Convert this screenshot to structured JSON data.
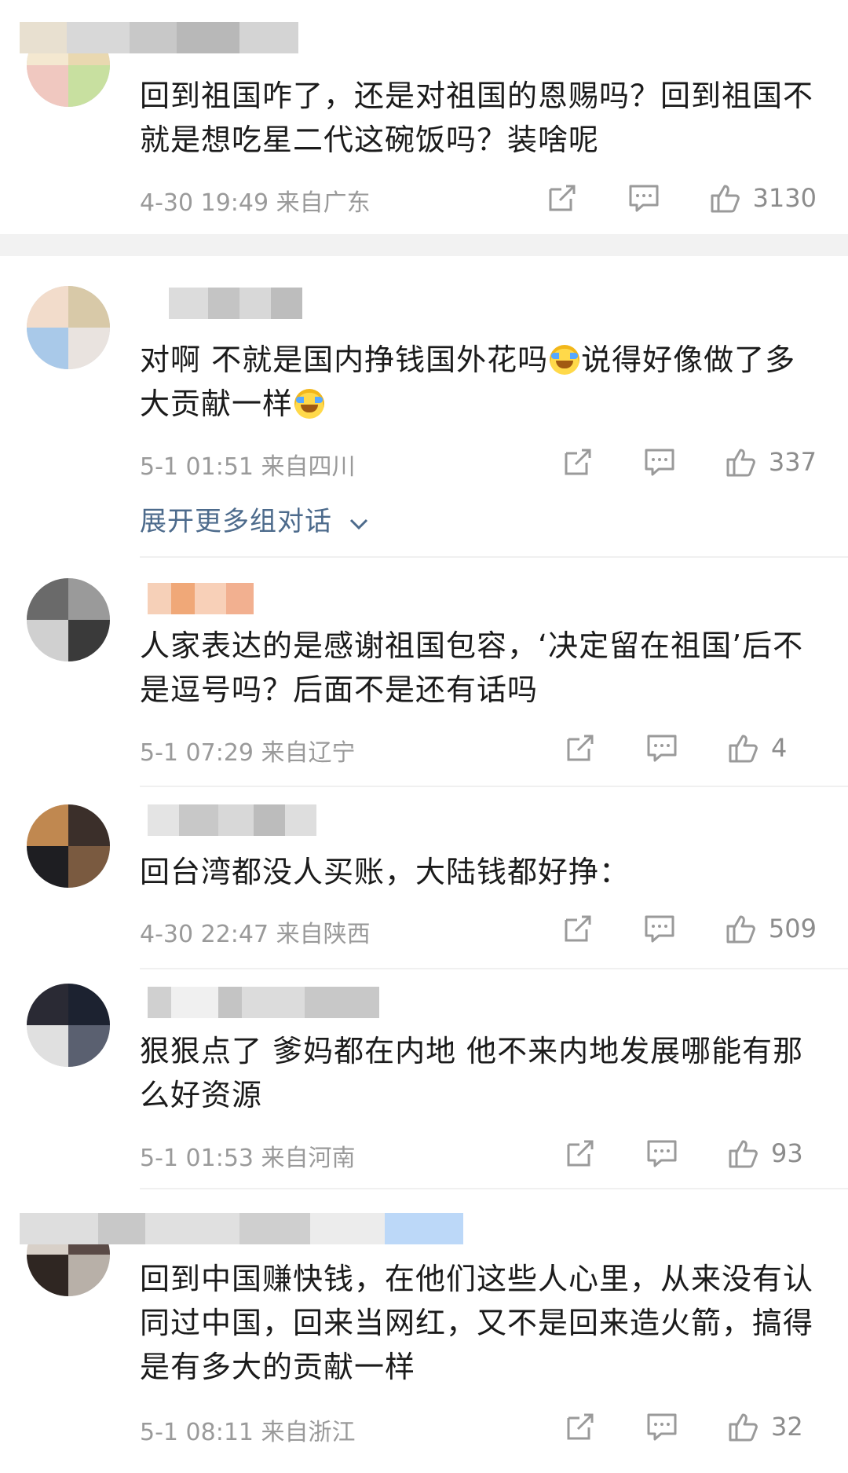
{
  "comments": [
    {
      "text": "回到祖国咋了，还是对祖国的恩赐吗？回到祖国不就是想吃星二代这碗饭吗？装啥呢",
      "meta": "4-30 19:49 来自广东",
      "likes": "3130",
      "avatar_colors": [
        "#e9d8b0",
        "#c8e0a0",
        "#f0c8c0",
        "#f4e8d0"
      ]
    },
    {
      "text_before": "对啊 不就是国内挣钱国外花吗",
      "text_mid": "说得好像做了多大贡献一样",
      "meta": "5-1 01:51 来自四川",
      "likes": "337",
      "avatar_colors": [
        "#d8c9a8",
        "#e9e3df",
        "#a9c9e9",
        "#f2dccb"
      ]
    },
    {
      "text": "人家表达的是感谢祖国包容，‘决定留在祖国’后不是逗号吗？后面不是还有话吗",
      "meta": "5-1 07:29 来自辽宁",
      "likes": "4",
      "avatar_colors": [
        "#9a9a9a",
        "#3a3a3a",
        "#d0d0d0",
        "#6a6a6a"
      ]
    },
    {
      "text": "回台湾都没人买账，大陆钱都好挣：",
      "meta": "4-30 22:47 来自陕西",
      "likes": "509",
      "avatar_colors": [
        "#3b2f2a",
        "#7a5a40",
        "#1e1e22",
        "#c08850"
      ]
    },
    {
      "text": "狠狠点了 爹妈都在内地 他不来内地发展哪能有那么好资源",
      "meta": "5-1 01:53 来自河南",
      "likes": "93",
      "avatar_colors": [
        "#1c2230",
        "#5a6070",
        "#e0e0e0",
        "#2a2a34"
      ]
    },
    {
      "text": "回到中国赚快钱，在他们这些人心里，从来没有认同过中国，回来当网红，又不是回来造火箭，搞得是有多大的贡献一样",
      "meta": "5-1 08:11 来自浙江",
      "likes": "32",
      "avatar_colors": [
        "#5a4a46",
        "#b8b0a8",
        "#2f2622",
        "#d8d0c8"
      ]
    }
  ],
  "expand_link": "展开更多组对话",
  "icons": {
    "share": "share-icon",
    "comment": "comment-icon",
    "like": "thumbs-up-icon",
    "expand": "chevron-down-icon"
  },
  "colors": {
    "link": "#4d6b8c",
    "meta": "#9a9a9a",
    "separator": "#f2f2f2"
  }
}
